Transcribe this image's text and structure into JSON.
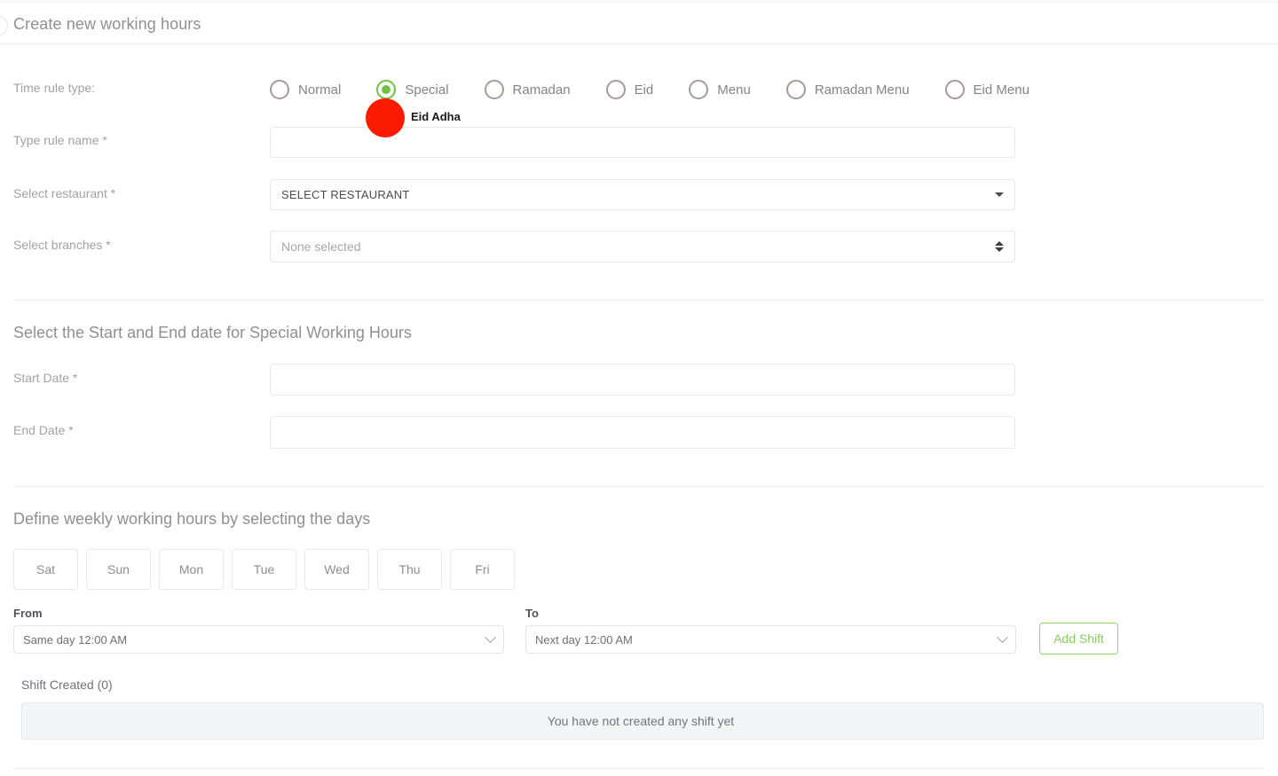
{
  "header": {
    "title": "Create new working hours"
  },
  "time_rule": {
    "label": "Time rule type:",
    "options": [
      {
        "label": "Normal",
        "selected": false
      },
      {
        "label": "Special",
        "selected": true
      },
      {
        "label": "Ramadan",
        "selected": false
      },
      {
        "label": "Eid",
        "selected": false
      },
      {
        "label": "Menu",
        "selected": false
      },
      {
        "label": "Ramadan Menu",
        "selected": false
      },
      {
        "label": "Eid Menu",
        "selected": false
      }
    ]
  },
  "annotation": {
    "marker_color": "#fb1b00",
    "label": "Eid Adha"
  },
  "fields": {
    "rule_name": {
      "label": "Type rule name *",
      "value": "",
      "placeholder": ""
    },
    "restaurant": {
      "label": "Select restaurant *",
      "value": "SELECT RESTAURANT",
      "icon": "chevron-down-icon"
    },
    "branches": {
      "label": "Select branches *",
      "value": "None selected",
      "icon": "spinner-arrows-icon"
    }
  },
  "date_section": {
    "heading": "Select the Start and End date for Special Working Hours",
    "start_date": {
      "label": "Start Date *",
      "value": "",
      "placeholder": ""
    },
    "end_date": {
      "label": "End Date *",
      "value": "",
      "placeholder": ""
    }
  },
  "weekly_section": {
    "heading": "Define weekly working hours by selecting the days",
    "days": [
      {
        "label": "Sat"
      },
      {
        "label": "Sun"
      },
      {
        "label": "Mon"
      },
      {
        "label": "Tue"
      },
      {
        "label": "Wed"
      },
      {
        "label": "Thu"
      },
      {
        "label": "Fri"
      }
    ],
    "from": {
      "caption": "From",
      "value": "Same day 12:00 AM"
    },
    "to": {
      "caption": "To",
      "value": "Next day 12:00 AM"
    },
    "add_shift_label": "Add Shift",
    "shift_created_label": "Shift Created (0)",
    "shift_empty_text": "You have not created any shift yet"
  },
  "colors": {
    "accent_green": "#72c241",
    "marker_red": "#fb1b00",
    "text_muted": "#a2a2a8",
    "border": "#e9e9ec"
  }
}
